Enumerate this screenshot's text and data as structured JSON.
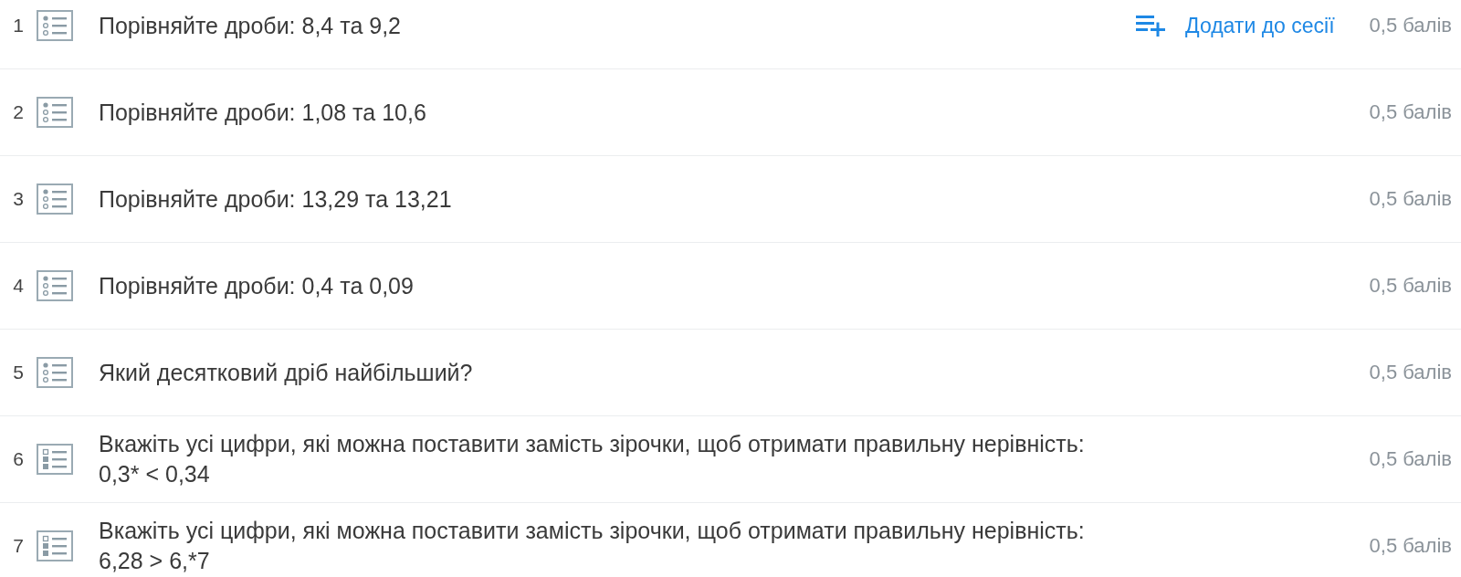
{
  "questions": [
    {
      "number": "1",
      "kind": "single",
      "text": "Порівняйте дроби: 8,4 та 9,2",
      "action": "Додати до сесії",
      "points": "0,5 балів"
    },
    {
      "number": "2",
      "kind": "single",
      "text": "Порівняйте дроби: 1,08 та 10,6",
      "points": "0,5 балів"
    },
    {
      "number": "3",
      "kind": "single",
      "text": "Порівняйте дроби: 13,29 та 13,21",
      "points": "0,5 балів"
    },
    {
      "number": "4",
      "kind": "single",
      "text": "Порівняйте дроби: 0,4 та 0,09",
      "points": "0,5 балів"
    },
    {
      "number": "5",
      "kind": "single",
      "text": "Який десятковий дріб найбільший?",
      "points": "0,5 балів"
    },
    {
      "number": "6",
      "kind": "multiple",
      "text": "Вкажіть усі цифри, які можна поставити замість зірочки, щоб отримати правильну нерівність: 0,3* < 0,34",
      "points": "0,5 балів"
    },
    {
      "number": "7",
      "kind": "multiple",
      "text": "Вкажіть усі цифри, які можна поставити замість зірочки, щоб отримати правильну нерівність: 6,28 > 6,*7",
      "points": "0,5 балів"
    }
  ]
}
